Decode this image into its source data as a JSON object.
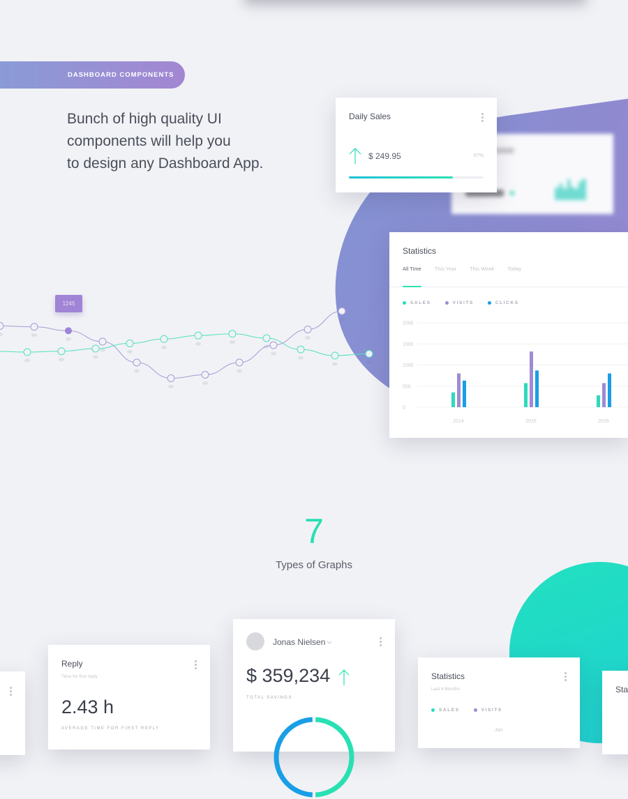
{
  "colors": {
    "green": "#29e0b3",
    "purple": "#a084d6",
    "blue": "#1a9ee6",
    "background": "#f1f2f6"
  },
  "section": {
    "pill_label": "DASHBOARD COMPONENTS",
    "lead_text": "Bunch of high quality UI\ncomponents will help you\nto design any Dashboard App."
  },
  "daily_sales": {
    "title": "Daily Sales",
    "menu_icon": "kebab-icon",
    "trend_icon": "arrow-up-icon",
    "value": "$ 249.95",
    "percent_label": "67%",
    "progress": 0.77
  },
  "line_chart": {
    "tooltip": "1245",
    "series": [
      {
        "name": "purple",
        "values": [
          1300,
          1290,
          1245,
          1120,
          880,
          700,
          740,
          880,
          1080,
          1260,
          1470
        ]
      },
      {
        "name": "green",
        "values": [
          1010,
          1000,
          1010,
          1040,
          1100,
          1150,
          1190,
          1210,
          1160,
          1030,
          960,
          980
        ]
      }
    ]
  },
  "statistics": {
    "title": "Statistics",
    "tabs": [
      {
        "label": "All Time",
        "active": true
      },
      {
        "label": "This Year",
        "active": false
      },
      {
        "label": "This Week",
        "active": false
      },
      {
        "label": "Today",
        "active": false
      }
    ],
    "legend": [
      {
        "label": "SALES",
        "color": "#29dcbf"
      },
      {
        "label": "VISITS",
        "color": "#9e8bd3"
      },
      {
        "label": "CLICKS",
        "color": "#1a9ee6"
      }
    ]
  },
  "chart_data": {
    "type": "bar",
    "title": "Statistics",
    "categories": [
      "2014",
      "2015",
      "2016"
    ],
    "series": [
      {
        "name": "SALES",
        "values": [
          350,
          570,
          280
        ]
      },
      {
        "name": "VISITS",
        "values": [
          800,
          1320,
          570
        ]
      },
      {
        "name": "CLICKS",
        "values": [
          630,
          870,
          800
        ]
      }
    ],
    "yticks": [
      0,
      500,
      1000,
      1500,
      2000
    ],
    "ylim": [
      0,
      2000
    ],
    "grid": true,
    "legend_position": "top-left",
    "xlabel": "",
    "ylabel": ""
  },
  "graphs": {
    "count": "7",
    "label": "Types of Graphs"
  },
  "reply": {
    "title": "Reply",
    "subtitle": "Time for first reply",
    "value": "2.43 h",
    "caption": "AVERAGE TIME FOR FIRST REPLY"
  },
  "savings": {
    "user_name": "Jonas Nielsen",
    "amount": "$ 359,234",
    "caption": "TOTAL SAVINGS",
    "donut": [
      {
        "name": "blue",
        "fraction": 0.5,
        "color": "#1a9ee6"
      },
      {
        "name": "green",
        "fraction": 0.5,
        "color": "#29e0b3"
      }
    ]
  },
  "statistics_small": {
    "title": "Statistics",
    "subtitle": "Last 6 Months",
    "legend": [
      {
        "label": "SALES",
        "color": "#29dcbf"
      },
      {
        "label": "VISITS",
        "color": "#9e8bd3"
      }
    ],
    "month": "Jan"
  },
  "statistics_partial": {
    "title": "Stat"
  }
}
